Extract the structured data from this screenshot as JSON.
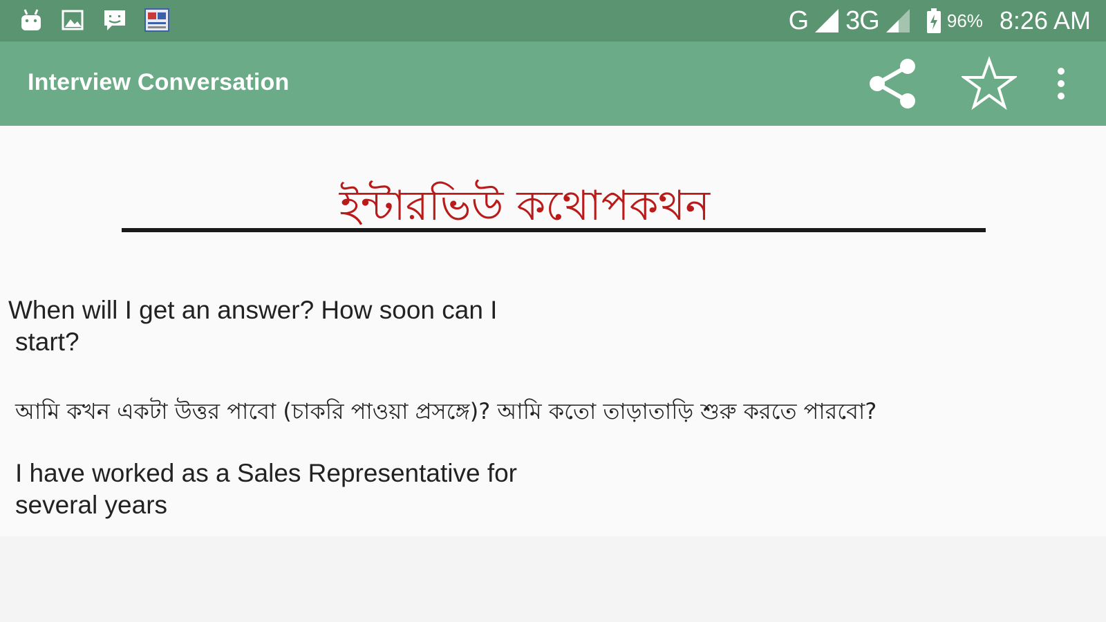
{
  "status_bar": {
    "icons": [
      "android-icon",
      "image-icon",
      "message-icon",
      "app-icon"
    ],
    "network_1": "G",
    "network_2": "3G",
    "battery": "96%",
    "time": "8:26 AM"
  },
  "app_bar": {
    "title": "Interview Conversation",
    "actions": [
      "share-icon",
      "star-icon",
      "more-vert-icon"
    ]
  },
  "content": {
    "heading": "ইন্টারভিউ কথোপকথন",
    "question_line1": "When will I get an answer? How soon can I",
    "question_line2": "start?",
    "translation": "আমি কখন একটা উত্তর পাবো (চাকরি পাওয়া প্রসঙ্গে)? আমি কতো তাড়াতাড়ি শুরু করতে পারবো?",
    "answer_line1": "I have worked as a Sales Representative for",
    "answer_line2": "several years"
  },
  "colors": {
    "status_bar": "#5a9470",
    "app_bar": "#6cab87",
    "heading": "#b91a1a"
  }
}
